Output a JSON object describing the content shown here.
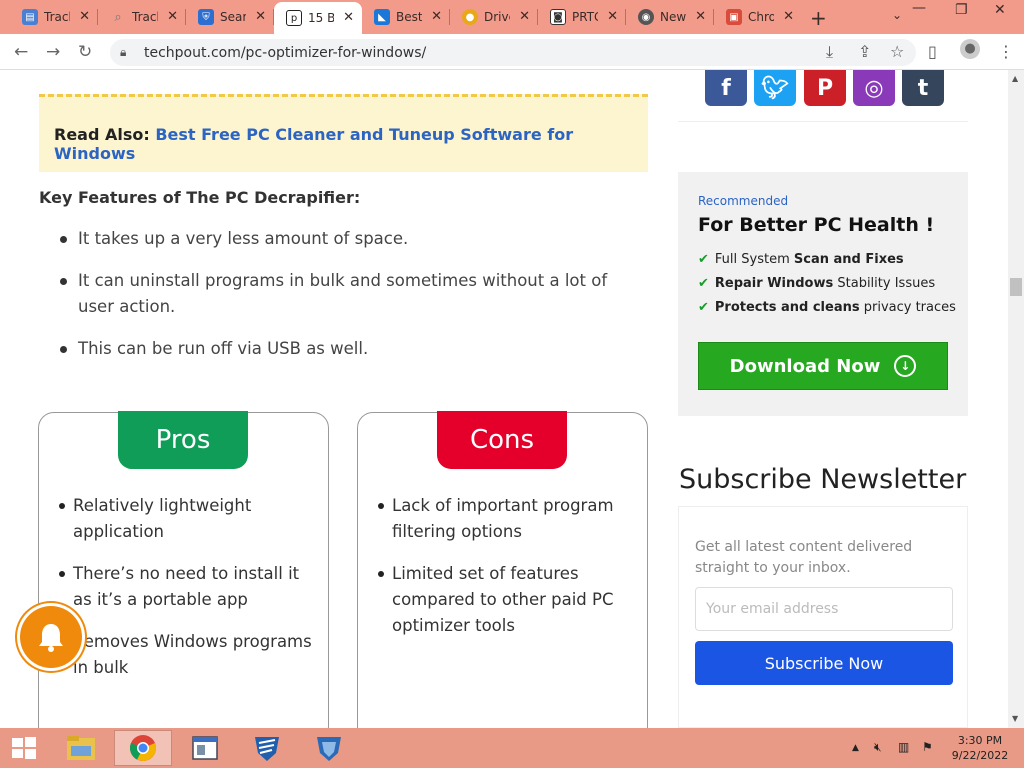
{
  "browser": {
    "tabs": [
      {
        "title": "Track",
        "icon": "clipboard-icon",
        "color": "#4a7fd1",
        "active": false
      },
      {
        "title": "Track",
        "icon": "search-icon",
        "color": "#777777",
        "active": false
      },
      {
        "title": "Sear",
        "icon": "shield-icon",
        "color": "#2d6fd0",
        "active": false
      },
      {
        "title": "15 B",
        "icon": "techpout-icon",
        "color": "#222222",
        "active": true
      },
      {
        "title": "Best",
        "icon": "photo-icon",
        "color": "#1b78d8",
        "active": false
      },
      {
        "title": "Drive",
        "icon": "chrome-icon",
        "color": "#e8a817",
        "active": false
      },
      {
        "title": "PRTG",
        "icon": "prtg-icon",
        "color": "#333333",
        "active": false
      },
      {
        "title": "New",
        "icon": "globe-icon",
        "color": "#555555",
        "active": false
      },
      {
        "title": "Chro",
        "icon": "chrome-store-icon",
        "color": "#d94b3b",
        "active": false
      }
    ],
    "url": "techpout.com/pc-optimizer-for-windows/"
  },
  "article": {
    "read_also_label": "Read Also:",
    "read_also_link": "Best Free PC Cleaner and Tuneup Software for Windows",
    "features_heading": "Key Features of The PC Decrapifier:",
    "features": [
      "It takes up a very less amount of space.",
      "It can uninstall programs in bulk and sometimes without a lot of user action.",
      "This can be run off via USB as well."
    ],
    "pros_label": "Pros",
    "pros": [
      "Relatively lightweight application",
      "There’s no need to install it as it’s a portable app",
      "Removes Windows programs in bulk"
    ],
    "cons_label": "Cons",
    "cons": [
      "Lack of important program filtering options",
      "Limited set of features compared to other paid PC optimizer tools"
    ]
  },
  "sidebar": {
    "social": [
      {
        "icon": "facebook-icon",
        "glyph": "f",
        "color": "#3b5998"
      },
      {
        "icon": "twitter-icon",
        "glyph": "t",
        "color": "#1da1f2"
      },
      {
        "icon": "pinterest-icon",
        "glyph": "p",
        "color": "#cb2027"
      },
      {
        "icon": "instagram-icon",
        "glyph": "◎",
        "color": "#8a3ab9"
      },
      {
        "icon": "tumblr-icon",
        "glyph": "t",
        "color": "#35465c"
      }
    ],
    "promo": {
      "recommended": "Recommended",
      "heading": "For Better PC Health !",
      "checks": [
        {
          "bold": "",
          "normal": "Full System ",
          "bold2": "Scan and Fixes",
          "tail": ""
        },
        {
          "bold": "Repair Windows",
          "normal": " Stability Issues",
          "bold2": "",
          "tail": ""
        },
        {
          "bold": "Protects and cleans",
          "normal": " privacy traces",
          "bold2": "",
          "tail": ""
        }
      ],
      "download_label": "Download Now"
    },
    "newsletter": {
      "heading": "Subscribe Newsletter",
      "text": "Get all latest content delivered straight to your inbox.",
      "email_placeholder": "Your email address",
      "button_label": "Subscribe Now"
    }
  },
  "taskbar": {
    "time": "3:30 PM",
    "date": "9/22/2022"
  }
}
